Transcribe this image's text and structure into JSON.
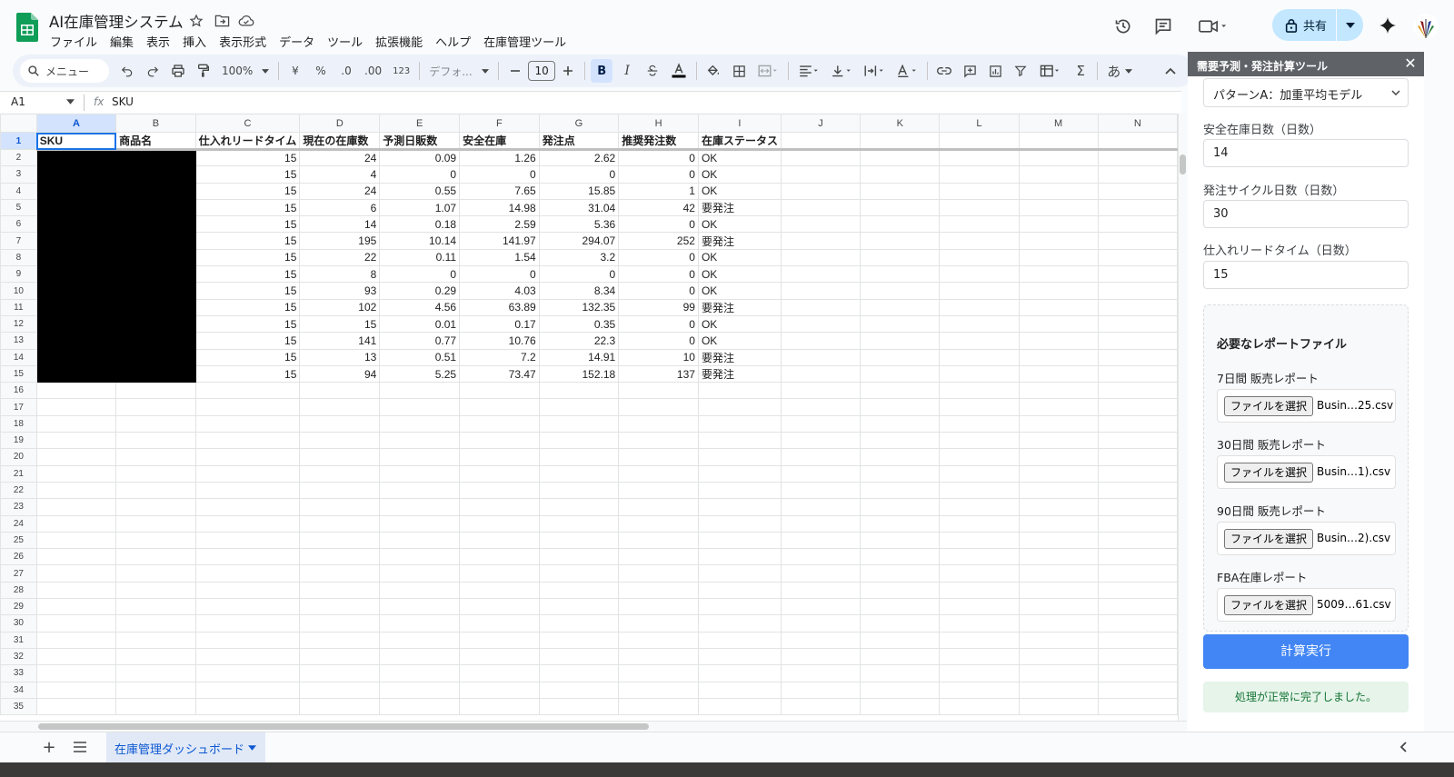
{
  "app": {
    "title": "AI在庫管理システム",
    "menu": [
      "ファイル",
      "編集",
      "表示",
      "挿入",
      "表示形式",
      "データ",
      "ツール",
      "拡張機能",
      "ヘルプ",
      "在庫管理ツール"
    ],
    "share_label": "共有"
  },
  "toolbar": {
    "search_label": "メニュー",
    "zoom": "100%",
    "currency": "¥",
    "percent": "%",
    "dec_decrease": ".0",
    "dec_increase": ".00",
    "number_format": "123",
    "font": "デフォ...",
    "font_size": "10",
    "bold": "B",
    "italic": "I",
    "sigma": "Σ",
    "ime": "あ"
  },
  "formula_bar": {
    "cell_ref": "A1",
    "fx": "fx",
    "value": "SKU"
  },
  "sheet": {
    "columns": [
      "A",
      "B",
      "C",
      "D",
      "E",
      "F",
      "G",
      "H",
      "I",
      "J",
      "K",
      "L",
      "M",
      "N"
    ],
    "row_numbers": [
      "1",
      "2",
      "3",
      "4",
      "5",
      "6",
      "7",
      "8",
      "9",
      "10",
      "11",
      "12",
      "13",
      "14",
      "15",
      "16",
      "17",
      "18",
      "19",
      "20",
      "21",
      "22",
      "23",
      "24",
      "25",
      "26",
      "27",
      "28",
      "29",
      "30",
      "31",
      "32",
      "33",
      "34",
      "35"
    ],
    "header": [
      "SKU",
      "商品名",
      "仕入れリードタイム",
      "現在の在庫数",
      "予測日販数",
      "安全在庫",
      "発注点",
      "推奨発注数",
      "在庫ステータス"
    ],
    "rows": [
      [
        "15",
        "24",
        "0.09",
        "1.26",
        "2.62",
        "0",
        "OK"
      ],
      [
        "15",
        "4",
        "0",
        "0",
        "0",
        "0",
        "OK"
      ],
      [
        "15",
        "24",
        "0.55",
        "7.65",
        "15.85",
        "1",
        "OK"
      ],
      [
        "15",
        "6",
        "1.07",
        "14.98",
        "31.04",
        "42",
        "要発注"
      ],
      [
        "15",
        "14",
        "0.18",
        "2.59",
        "5.36",
        "0",
        "OK"
      ],
      [
        "15",
        "195",
        "10.14",
        "141.97",
        "294.07",
        "252",
        "要発注"
      ],
      [
        "15",
        "22",
        "0.11",
        "1.54",
        "3.2",
        "0",
        "OK"
      ],
      [
        "15",
        "8",
        "0",
        "0",
        "0",
        "0",
        "OK"
      ],
      [
        "15",
        "93",
        "0.29",
        "4.03",
        "8.34",
        "0",
        "OK"
      ],
      [
        "15",
        "102",
        "4.56",
        "63.89",
        "132.35",
        "99",
        "要発注"
      ],
      [
        "15",
        "15",
        "0.01",
        "0.17",
        "0.35",
        "0",
        "OK"
      ],
      [
        "15",
        "141",
        "0.77",
        "10.76",
        "22.3",
        "0",
        "OK"
      ],
      [
        "15",
        "13",
        "0.51",
        "7.2",
        "14.91",
        "10",
        "要発注"
      ],
      [
        "15",
        "94",
        "5.25",
        "73.47",
        "152.18",
        "137",
        "要発注"
      ]
    ]
  },
  "sheet_tab": {
    "name": "在庫管理ダッシュボード",
    "add": "+"
  },
  "sidebar": {
    "title": "需要予測・発注計算ツール",
    "close": "✕",
    "model": "パターンA：加重平均モデル",
    "fields": [
      {
        "label": "安全在庫日数（日数）",
        "value": "14"
      },
      {
        "label": "発注サイクル日数（日数）",
        "value": "30"
      },
      {
        "label": "仕入れリードタイム（日数）",
        "value": "15"
      }
    ],
    "files_title": "必要なレポートファイル",
    "files": [
      {
        "label": "7日間 販売レポート",
        "button": "ファイルを選択",
        "file": "Busin…25.csv"
      },
      {
        "label": "30日間 販売レポート",
        "button": "ファイルを選択",
        "file": "Busin…1).csv"
      },
      {
        "label": "90日間 販売レポート",
        "button": "ファイルを選択",
        "file": "Busin…2).csv"
      },
      {
        "label": "FBA在庫レポート",
        "button": "ファイルを選択",
        "file": "5009…61.csv"
      }
    ],
    "run_label": "計算実行",
    "status": "処理が正常に完了しました。"
  }
}
